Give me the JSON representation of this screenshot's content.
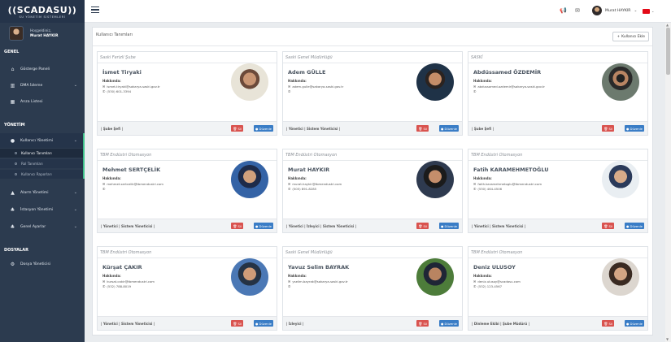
{
  "sidebar": {
    "logo": "SCADASU",
    "logo_sub": "SU YÖNETİM SİSTEMLERİ",
    "greeting": "Hoşgeldiniz,",
    "user_name": "Murat HAYKIR",
    "sections": {
      "genel": "GENEL",
      "yonetim": "YÖNETİM",
      "dosyalar": "DOSYALAR"
    },
    "items": {
      "dashboard": "Gösterge Paneli",
      "dma": "DMA İzleme",
      "alarm_list": "Arıza Listesi",
      "user_mgmt": "Kullanıcı Yönetimi",
      "user_defs": "Kullanıcı Tanımları",
      "role_defs": "Rol Tanımları",
      "user_reports": "Kullanıcı Raporları",
      "alarm_mgmt": "Alarm Yönetimi",
      "station_mgmt": "İstasyon Yönetimi",
      "general_settings": "Genel Ayarlar",
      "file_manager": "Dosya Yöneticisi"
    }
  },
  "topbar": {
    "user_name": "Murat HAYKIR"
  },
  "panel": {
    "title": "Kullanıcı Tanımları",
    "add_button": "Kullanıcı Ekle"
  },
  "labels": {
    "about": "Hakkında:",
    "delete": "Sil",
    "edit": "Düzenle"
  },
  "cards": [
    {
      "org": "Saski Ferizli Şube",
      "name": "İsmet Tiryaki",
      "email": "ismet.tiryaki@sakarya-saski.gov.tr",
      "phone": "(530) 601-3394",
      "roles": "| Şube Şefi |"
    },
    {
      "org": "Saski Genel Müdürlüğü",
      "name": "Adem GÜLLE",
      "email": "adem.gulle@sakarya-saski.gov.tr",
      "phone": "",
      "roles": "| Yönetici | Sistem Yöneticisi |"
    },
    {
      "org": "SASKİ",
      "name": "Abdüssamed ÖZDEMİR",
      "email": "abdussamed.ozdemir@sakarya-saski.gov.tr",
      "phone": "",
      "roles": "| Şube Şefi |"
    },
    {
      "org": "TBM Endüstri Otomasyon",
      "name": "Mehmet SERTÇELİK",
      "email": "mehmet.sertcelik@tbmendustri.com",
      "phone": "",
      "roles": "| Yönetici | Sistem Yöneticisi |"
    },
    {
      "org": "TBM Endüstri Otomasyon",
      "name": "Murat HAYKIR",
      "email": "murat.haykir@tbmendustri.com",
      "phone": "(505) 891-8285",
      "roles": "| Yönetici | İzleyici | Sistem Yöneticisi |"
    },
    {
      "org": "TBM Endüstri Otomasyon",
      "name": "Fatih KARAMEHMETOĞLU",
      "email": "fatih.karamehmetoglu@tbmendustri.com",
      "phone": "(530) 464-4506",
      "roles": "| Yönetici | Sistem Yöneticisi |"
    },
    {
      "org": "TBM Endüstri Otomasyon",
      "name": "Kürşat ÇAKIR",
      "email": "kursat.cakir@tbmendustri.com",
      "phone": "(532) 788-8019",
      "roles": "| Yönetici | Sistem Yöneticisi |"
    },
    {
      "org": "Saski Genel Müdürlüğü",
      "name": "Yavuz Selim BAYRAK",
      "email": "yselim.bayrak@sakarya-saski.gov.tr",
      "phone": "",
      "roles": "| İzleyici |"
    },
    {
      "org": "TBM Endüstri Otomasyon",
      "name": "Deniz ULUSOY",
      "email": "deniz.ulusoy@scadasu.com",
      "phone": "(532) 123-4567",
      "roles": "| Dinleme Ekibi | Şube Müdürü |"
    }
  ]
}
